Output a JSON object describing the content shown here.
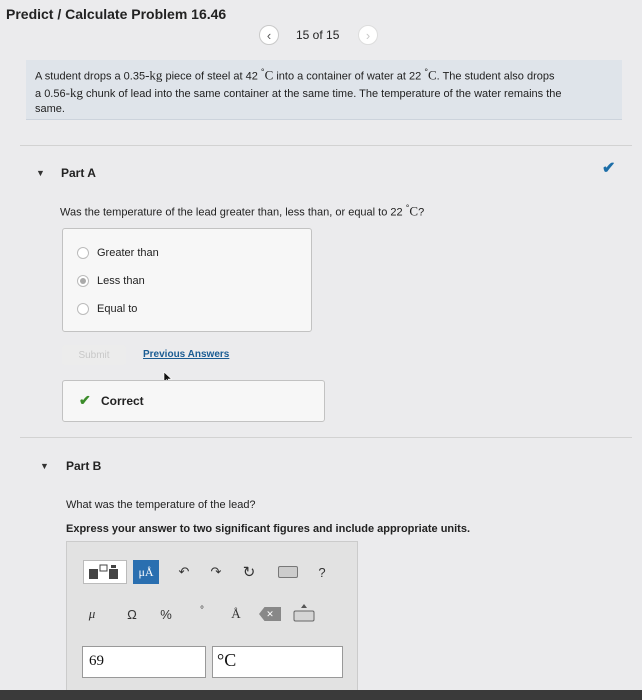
{
  "header": {
    "title": "Predict / Calculate Problem 16.46",
    "pagination": {
      "prev_icon": "chevron-left-icon",
      "count": "15 of 15",
      "next_icon": "chevron-right-icon"
    }
  },
  "problem": {
    "line1_a": "A student drops a ",
    "mass_steel": "0.35",
    "unit_kg": "-kg",
    "line1_b": " piece of steel at ",
    "temp_steel": "42",
    "deg": "°",
    "unit_c": "C",
    "line1_c": " into a container of water at ",
    "temp_water": "22",
    "line1_d": ". The student also drops",
    "line2_a": "a ",
    "mass_lead": "0.56",
    "line2_b": " chunk of lead into the same container at the same time. The temperature of the water remains the",
    "line3": "same."
  },
  "part_a": {
    "label": "Part A",
    "status_icon": "checkmark-icon",
    "question_a": "Was the temperature of the lead greater than, less than, or equal to ",
    "question_temp": "22",
    "question_b": "?",
    "options": [
      {
        "label": "Greater than",
        "selected": false
      },
      {
        "label": "Less than",
        "selected": true
      },
      {
        "label": "Equal to",
        "selected": false
      }
    ],
    "submit_label": "Submit",
    "previous_answers_label": "Previous Answers",
    "feedback": "Correct"
  },
  "part_b": {
    "label": "Part B",
    "question": "What was the temperature of the lead?",
    "instructions": "Express your answer to two significant figures and include appropriate units.",
    "toolbar": {
      "mu_a_label": "μÅ",
      "undo_icon": "undo-icon",
      "redo_icon": "redo-icon",
      "reset_icon": "reset-icon",
      "keyboard_icon": "keyboard-icon",
      "help_label": "?",
      "mu_symbol": "μ",
      "omega_symbol": "Ω",
      "percent_symbol": "%",
      "degree_symbol": "°",
      "angstrom_symbol": "Å",
      "delete_icon": "delete-icon",
      "keyboard2_icon": "keyboard-icon"
    },
    "answer_value": "69",
    "answer_units": "°C"
  },
  "colors": {
    "problem_bg": "#dfe4ea",
    "link": "#1a5c93",
    "correct_green": "#3b8c2a",
    "mu_button": "#2a6fb0"
  }
}
